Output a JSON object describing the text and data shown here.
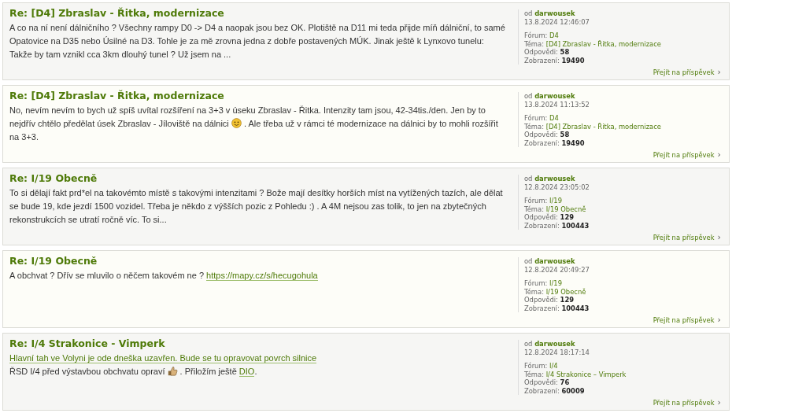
{
  "posts": [
    {
      "title": "Re: [D4] Zbraslav - Řitka, modernizace",
      "body": [
        [
          {
            "kind": "text",
            "text": "A co na ní není dálničního ? Všechny rampy D0 -> D4 a naopak jsou bez OK. Plotiště na D11 mi teda přijde míň dálniční, to samé Opatovice na D35 nebo Úsilné na D3. Tohle je za mě zrovna jedna z dobře postavených MÚK. Jinak ještě k Lynxovo tunelu: Takže by tam vznikl cca 3km dlouhý tunel ? Už jsem na ..."
          }
        ]
      ],
      "author_prefix": "od",
      "author": "darwousek",
      "date": "13.8.2024 12:46:07",
      "forum_label": "Fórum:",
      "forum": "D4",
      "topic_label": "Téma:",
      "topic": "[D4] Zbraslav - Řitka, modernizace",
      "replies_label": "Odpovědi:",
      "replies": "58",
      "views_label": "Zobrazení:",
      "views": "19490",
      "goto": "Přejít na příspěvek",
      "goto_icon": "›"
    },
    {
      "title": "Re: [D4] Zbraslav - Řitka, modernizace",
      "body": [
        [
          {
            "kind": "text",
            "text": "No, nevím nevím to bych už spíš uvítal rozšíření na 3+3 v úseku Zbraslav - Řitka. Intenzity tam jsou, 42-34tis./den. Jen by to nejdřív chtělo předělat úsek Zbraslav - Jíloviště na dálnici "
          },
          {
            "kind": "smiley"
          },
          {
            "kind": "text",
            "text": " . Ale třeba už v rámci té modernizace na dálnici by to mohli rozšířit na 3+3."
          }
        ]
      ],
      "author_prefix": "od",
      "author": "darwousek",
      "date": "13.8.2024 11:13:52",
      "forum_label": "Fórum:",
      "forum": "D4",
      "topic_label": "Téma:",
      "topic": "[D4] Zbraslav - Řitka, modernizace",
      "replies_label": "Odpovědi:",
      "replies": "58",
      "views_label": "Zobrazení:",
      "views": "19490",
      "goto": "Přejít na příspěvek",
      "goto_icon": "›"
    },
    {
      "title": "Re: I/19 Obecně",
      "body": [
        [
          {
            "kind": "text",
            "text": "To si dělají fakt prd*el na takovémto místě s takovými intenzitami ? Bože mají desítky horších míst na vytížených tazích, ale dělat se bude 19, kde jezdí 1500 vozidel. Třeba je někdo z výšších pozic z Pohledu :) . A 4M nejsou zas tolik, to jen na zbytečných rekonstrukcích se utratí ročně víc. To si..."
          }
        ]
      ],
      "author_prefix": "od",
      "author": "darwousek",
      "date": "12.8.2024 23:05:02",
      "forum_label": "Fórum:",
      "forum": "I/19",
      "topic_label": "Téma:",
      "topic": "I/19 Obecně",
      "replies_label": "Odpovědi:",
      "replies": "129",
      "views_label": "Zobrazení:",
      "views": "100443",
      "goto": "Přejít na příspěvek",
      "goto_icon": "›"
    },
    {
      "title": "Re: I/19 Obecně",
      "body": [
        [
          {
            "kind": "text",
            "text": "A obchvat ? Dřív se mluvilo o něčem takovém ne ? "
          },
          {
            "kind": "link",
            "text": "https://mapy.cz/s/hecugohula"
          }
        ]
      ],
      "author_prefix": "od",
      "author": "darwousek",
      "date": "12.8.2024 20:49:27",
      "forum_label": "Fórum:",
      "forum": "I/19",
      "topic_label": "Téma:",
      "topic": "I/19 Obecně",
      "replies_label": "Odpovědi:",
      "replies": "129",
      "views_label": "Zobrazení:",
      "views": "100443",
      "goto": "Přejít na příspěvek",
      "goto_icon": "›"
    },
    {
      "title": "Re: I/4 Strakonice - Vimperk",
      "body": [
        [
          {
            "kind": "link",
            "text": "Hlavní tah ve Volyni je ode dneška uzavřen. Bude se tu opravovat povrch silnice"
          }
        ],
        [
          {
            "kind": "text",
            "text": "ŘSD I/4 před výstavbou obchvatu opraví "
          },
          {
            "kind": "thumb"
          },
          {
            "kind": "text",
            "text": " . Přiložím ještě "
          },
          {
            "kind": "link",
            "text": "DIO"
          },
          {
            "kind": "text",
            "text": "."
          }
        ]
      ],
      "author_prefix": "od",
      "author": "darwousek",
      "date": "12.8.2024 18:17:14",
      "forum_label": "Fórum:",
      "forum": "I/4",
      "topic_label": "Téma:",
      "topic": "I/4 Strakonice – Vimperk",
      "replies_label": "Odpovědi:",
      "replies": "76",
      "views_label": "Zobrazení:",
      "views": "60009",
      "goto": "Přejít na příspěvek",
      "goto_icon": "›"
    }
  ]
}
